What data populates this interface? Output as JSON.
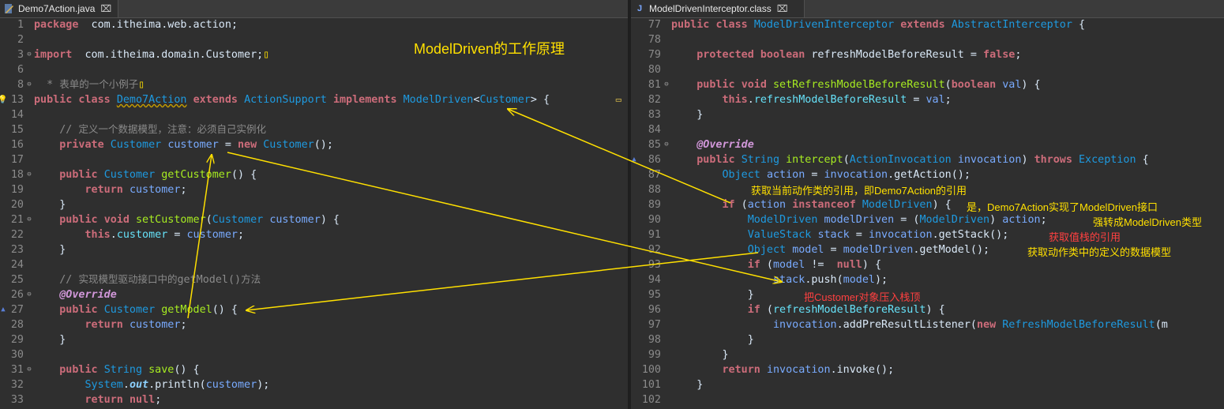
{
  "left_tab": {
    "label": "Demo7Action.java",
    "close": "⌧"
  },
  "right_tab": {
    "label": "ModelDrivenInterceptor.class",
    "close": "⌧"
  },
  "title_annotation": "ModelDriven的工作原理",
  "colors": {
    "background": "#2f2f2f",
    "keyword": "#cc6c7a",
    "type": "#1e9ae0",
    "method": "#a7ec21",
    "field": "#66e1f8",
    "annotation": "#d197d9",
    "arrow": "#ffe000",
    "note_yellow": "#ffe000",
    "note_red": "#ff4040"
  },
  "left_lines": [
    {
      "n": "1",
      "code": [
        [
          "k",
          "package"
        ],
        [
          "",
          "  com.itheima.web.action;"
        ]
      ]
    },
    {
      "n": "2",
      "code": []
    },
    {
      "n": "3",
      "marker": "fold",
      "code": [
        [
          "k",
          "import"
        ],
        [
          "",
          "  com.itheima.domain.Customer;"
        ],
        [
          "cm",
          "▯"
        ]
      ]
    },
    {
      "n": "6",
      "code": []
    },
    {
      "n": "8",
      "marker": "fold",
      "code": [
        [
          "c",
          "  * "
        ],
        [
          "c cz",
          "表单的一个小例子"
        ],
        [
          "cm",
          "▯"
        ]
      ]
    },
    {
      "n": "13",
      "marker": "bulb",
      "right_marker": "▭",
      "code": [
        [
          "k",
          "public"
        ],
        [
          "",
          ""
        ],
        [
          "k",
          " class"
        ],
        [
          "",
          " "
        ],
        [
          "lk",
          "Demo7Action"
        ],
        [
          "",
          " "
        ],
        [
          "k",
          "extends"
        ],
        [
          "",
          " "
        ],
        [
          "t",
          "ActionSupport"
        ],
        [
          "",
          " "
        ],
        [
          "k",
          "implements"
        ],
        [
          "",
          " "
        ],
        [
          "t",
          "ModelDriven"
        ],
        [
          "",
          "<"
        ],
        [
          "t",
          "Customer"
        ],
        [
          "",
          "> {"
        ]
      ]
    },
    {
      "n": "14",
      "code": []
    },
    {
      "n": "15",
      "code": [
        [
          "",
          "    "
        ],
        [
          "c",
          "// "
        ],
        [
          "c cz",
          "定义一个数据模型，注意：必须自己实例化"
        ]
      ]
    },
    {
      "n": "16",
      "code": [
        [
          "",
          "    "
        ],
        [
          "k",
          "private"
        ],
        [
          "",
          " "
        ],
        [
          "t",
          "Customer"
        ],
        [
          "",
          " "
        ],
        [
          "v",
          "customer"
        ],
        [
          "",
          " = "
        ],
        [
          "k",
          "new"
        ],
        [
          "",
          " "
        ],
        [
          "t",
          "Customer"
        ],
        [
          "",
          "();"
        ]
      ]
    },
    {
      "n": "17",
      "code": []
    },
    {
      "n": "18",
      "marker": "fold",
      "code": [
        [
          "",
          "    "
        ],
        [
          "k",
          "public"
        ],
        [
          "",
          " "
        ],
        [
          "t",
          "Customer"
        ],
        [
          "",
          " "
        ],
        [
          "m",
          "getCustomer"
        ],
        [
          "",
          "() {"
        ]
      ]
    },
    {
      "n": "19",
      "code": [
        [
          "",
          "        "
        ],
        [
          "k",
          "return"
        ],
        [
          "",
          " "
        ],
        [
          "v",
          "customer"
        ],
        [
          "",
          ";"
        ]
      ]
    },
    {
      "n": "20",
      "code": [
        [
          "",
          "    }"
        ]
      ]
    },
    {
      "n": "21",
      "marker": "fold",
      "code": [
        [
          "",
          "    "
        ],
        [
          "k",
          "public"
        ],
        [
          "",
          " "
        ],
        [
          "k",
          "void"
        ],
        [
          "",
          " "
        ],
        [
          "m",
          "setCustomer"
        ],
        [
          "",
          "("
        ],
        [
          "t",
          "Customer"
        ],
        [
          "",
          " "
        ],
        [
          "v",
          "customer"
        ],
        [
          "",
          ") {"
        ]
      ]
    },
    {
      "n": "22",
      "code": [
        [
          "",
          "        "
        ],
        [
          "k",
          "this"
        ],
        [
          "",
          "."
        ],
        [
          "f",
          "customer"
        ],
        [
          "",
          " = "
        ],
        [
          "v",
          "customer"
        ],
        [
          "",
          ";"
        ]
      ]
    },
    {
      "n": "23",
      "code": [
        [
          "",
          "    }"
        ]
      ]
    },
    {
      "n": "24",
      "code": []
    },
    {
      "n": "25",
      "code": [
        [
          "",
          "    "
        ],
        [
          "c",
          "// "
        ],
        [
          "c cz",
          "实现模型驱动接口中的"
        ],
        [
          "c",
          "getModel()"
        ],
        [
          "c cz",
          "方法"
        ]
      ]
    },
    {
      "n": "26",
      "marker": "fold",
      "code": [
        [
          "",
          "    "
        ],
        [
          "a",
          "@Override"
        ]
      ]
    },
    {
      "n": "27",
      "marker": "override",
      "code": [
        [
          "",
          "    "
        ],
        [
          "k",
          "public"
        ],
        [
          "",
          " "
        ],
        [
          "t",
          "Customer"
        ],
        [
          "",
          " "
        ],
        [
          "m",
          "getModel"
        ],
        [
          "",
          "() {"
        ]
      ]
    },
    {
      "n": "28",
      "code": [
        [
          "",
          "        "
        ],
        [
          "k",
          "return"
        ],
        [
          "",
          " "
        ],
        [
          "v",
          "customer"
        ],
        [
          "",
          ";"
        ]
      ]
    },
    {
      "n": "29",
      "code": [
        [
          "",
          "    }"
        ]
      ]
    },
    {
      "n": "30",
      "code": []
    },
    {
      "n": "31",
      "marker": "fold",
      "code": [
        [
          "",
          "    "
        ],
        [
          "k",
          "public"
        ],
        [
          "",
          " "
        ],
        [
          "t",
          "String"
        ],
        [
          "",
          " "
        ],
        [
          "m",
          "save"
        ],
        [
          "",
          "() {"
        ]
      ]
    },
    {
      "n": "32",
      "code": [
        [
          "",
          "        "
        ],
        [
          "t",
          "System"
        ],
        [
          "",
          "."
        ],
        [
          "sf",
          "out"
        ],
        [
          "",
          ".println("
        ],
        [
          "v",
          "customer"
        ],
        [
          "",
          ");"
        ]
      ]
    },
    {
      "n": "33",
      "code": [
        [
          "",
          "        "
        ],
        [
          "k",
          "return"
        ],
        [
          "",
          " "
        ],
        [
          "k",
          "null"
        ],
        [
          "",
          ";"
        ]
      ]
    }
  ],
  "right_lines": [
    {
      "n": "77",
      "code": [
        [
          "k",
          "public"
        ],
        [
          "",
          " "
        ],
        [
          "k",
          "class"
        ],
        [
          "",
          " "
        ],
        [
          "t",
          "ModelDrivenInterceptor"
        ],
        [
          "",
          " "
        ],
        [
          "k",
          "extends"
        ],
        [
          "",
          " "
        ],
        [
          "t",
          "AbstractInterceptor"
        ],
        [
          "",
          " {"
        ]
      ]
    },
    {
      "n": "78",
      "code": []
    },
    {
      "n": "79",
      "code": [
        [
          "",
          "    "
        ],
        [
          "k",
          "protected"
        ],
        [
          "",
          " "
        ],
        [
          "k",
          "boolean"
        ],
        [
          "",
          " refreshModelBeforeResult = "
        ],
        [
          "k",
          "false"
        ],
        [
          "",
          ";"
        ]
      ]
    },
    {
      "n": "80",
      "code": []
    },
    {
      "n": "81",
      "marker": "fold",
      "code": [
        [
          "",
          "    "
        ],
        [
          "k",
          "public"
        ],
        [
          "",
          " "
        ],
        [
          "k",
          "void"
        ],
        [
          "",
          " "
        ],
        [
          "m",
          "setRefreshModelBeforeResult"
        ],
        [
          "",
          "("
        ],
        [
          "k",
          "boolean"
        ],
        [
          "",
          " "
        ],
        [
          "v",
          "val"
        ],
        [
          "",
          ") {"
        ]
      ]
    },
    {
      "n": "82",
      "code": [
        [
          "",
          "        "
        ],
        [
          "k",
          "this"
        ],
        [
          "",
          "."
        ],
        [
          "f",
          "refreshModelBeforeResult"
        ],
        [
          "",
          " = "
        ],
        [
          "v",
          "val"
        ],
        [
          "",
          ";"
        ]
      ]
    },
    {
      "n": "83",
      "code": [
        [
          "",
          "    }"
        ]
      ]
    },
    {
      "n": "84",
      "code": []
    },
    {
      "n": "85",
      "marker": "fold",
      "code": [
        [
          "",
          "    "
        ],
        [
          "a",
          "@Override"
        ]
      ]
    },
    {
      "n": "86",
      "marker": "override",
      "code": [
        [
          "",
          "    "
        ],
        [
          "k",
          "public"
        ],
        [
          "",
          " "
        ],
        [
          "t",
          "String"
        ],
        [
          "",
          " "
        ],
        [
          "m",
          "intercept"
        ],
        [
          "",
          "("
        ],
        [
          "t",
          "ActionInvocation"
        ],
        [
          "",
          " "
        ],
        [
          "v",
          "invocation"
        ],
        [
          "",
          ") "
        ],
        [
          "k",
          "throws"
        ],
        [
          "",
          " "
        ],
        [
          "t",
          "Exception"
        ],
        [
          "",
          " {"
        ]
      ]
    },
    {
      "n": "87",
      "code": [
        [
          "",
          "        "
        ],
        [
          "t",
          "Object"
        ],
        [
          "",
          " "
        ],
        [
          "v",
          "action"
        ],
        [
          "",
          " = "
        ],
        [
          "v",
          "invocation"
        ],
        [
          "",
          ".getAction();"
        ]
      ]
    },
    {
      "n": "88",
      "code": []
    },
    {
      "n": "89",
      "code": [
        [
          "",
          "        "
        ],
        [
          "k",
          "if"
        ],
        [
          "",
          " ("
        ],
        [
          "v",
          "action"
        ],
        [
          "",
          " "
        ],
        [
          "k",
          "instanceof"
        ],
        [
          "",
          " "
        ],
        [
          "t",
          "ModelDriven"
        ],
        [
          "",
          ") {"
        ]
      ]
    },
    {
      "n": "90",
      "code": [
        [
          "",
          "            "
        ],
        [
          "t",
          "ModelDriven"
        ],
        [
          "",
          " "
        ],
        [
          "v",
          "modelDriven"
        ],
        [
          "",
          " = ("
        ],
        [
          "t",
          "ModelDriven"
        ],
        [
          "",
          ") "
        ],
        [
          "v",
          "action"
        ],
        [
          "",
          ";"
        ]
      ]
    },
    {
      "n": "91",
      "code": [
        [
          "",
          "            "
        ],
        [
          "t",
          "ValueStack"
        ],
        [
          "",
          " "
        ],
        [
          "v",
          "stack"
        ],
        [
          "",
          " = "
        ],
        [
          "v",
          "invocation"
        ],
        [
          "",
          ".getStack();"
        ]
      ]
    },
    {
      "n": "92",
      "code": [
        [
          "",
          "            "
        ],
        [
          "t",
          "Object"
        ],
        [
          "",
          " "
        ],
        [
          "v",
          "model"
        ],
        [
          "",
          " = "
        ],
        [
          "v",
          "modelDriven"
        ],
        [
          "",
          ".getModel();"
        ]
      ]
    },
    {
      "n": "93",
      "code": [
        [
          "",
          "            "
        ],
        [
          "k",
          "if"
        ],
        [
          "",
          " ("
        ],
        [
          "v",
          "model"
        ],
        [
          "",
          " !=  "
        ],
        [
          "k",
          "null"
        ],
        [
          "",
          ") {"
        ]
      ]
    },
    {
      "n": "94",
      "code": [
        [
          "",
          "                "
        ],
        [
          "v",
          "stack"
        ],
        [
          "",
          ".push("
        ],
        [
          "v",
          "model"
        ],
        [
          "",
          ");"
        ]
      ]
    },
    {
      "n": "95",
      "code": [
        [
          "",
          "            }"
        ]
      ]
    },
    {
      "n": "96",
      "code": [
        [
          "",
          "            "
        ],
        [
          "k",
          "if"
        ],
        [
          "",
          " ("
        ],
        [
          "f",
          "refreshModelBeforeResult"
        ],
        [
          "",
          ") {"
        ]
      ]
    },
    {
      "n": "97",
      "code": [
        [
          "",
          "                "
        ],
        [
          "v",
          "invocation"
        ],
        [
          "",
          ".addPreResultListener("
        ],
        [
          "k",
          "new"
        ],
        [
          "",
          " "
        ],
        [
          "t",
          "RefreshModelBeforeResult"
        ],
        [
          "",
          "(m"
        ]
      ]
    },
    {
      "n": "98",
      "code": [
        [
          "",
          "            }"
        ]
      ]
    },
    {
      "n": "99",
      "code": [
        [
          "",
          "        }"
        ]
      ]
    },
    {
      "n": "100",
      "code": [
        [
          "",
          "        "
        ],
        [
          "k",
          "return"
        ],
        [
          "",
          " "
        ],
        [
          "v",
          "invocation"
        ],
        [
          "",
          ".invoke();"
        ]
      ]
    },
    {
      "n": "101",
      "code": [
        [
          "",
          "    }"
        ]
      ]
    },
    {
      "n": "102",
      "code": []
    }
  ],
  "right_notes": [
    {
      "text": "获取当前动作类的引用，即Demo7Action的引用",
      "color": "#ffe000"
    },
    {
      "text": "是，Demo7Action实现了ModelDriven接口",
      "color": "#ffe000"
    },
    {
      "text": "强转成ModelDriven类型",
      "color": "#ffe000"
    },
    {
      "text": "获取值栈的引用",
      "color": "#ff4040"
    },
    {
      "text": "获取动作类中的定义的数据模型",
      "color": "#ffe000"
    },
    {
      "text": "把Customer对象压入栈顶",
      "color": "#ff4040"
    }
  ]
}
